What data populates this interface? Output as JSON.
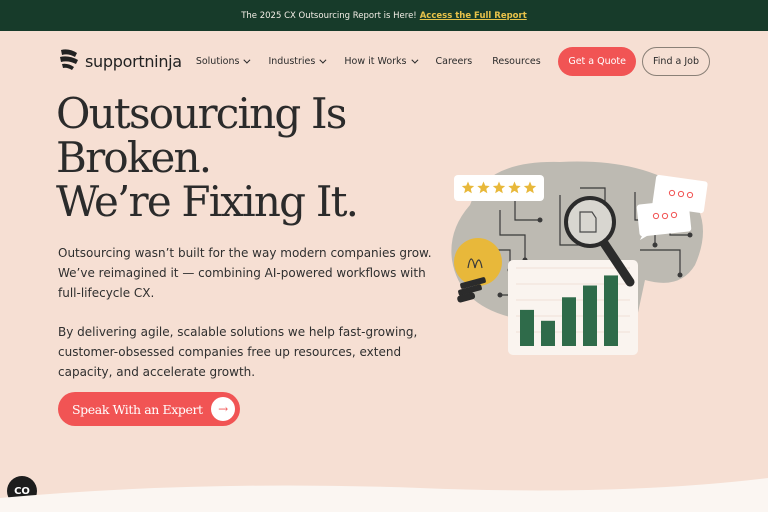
{
  "announcement": {
    "text": "The 2025 CX Outsourcing Report is Here!",
    "link": "Access the Full Report"
  },
  "brand": {
    "name": "supportninja",
    "logo_icon": "ninja-logo-icon"
  },
  "nav": {
    "items": [
      {
        "label": "Solutions",
        "has_dropdown": true
      },
      {
        "label": "Industries",
        "has_dropdown": true
      },
      {
        "label": "How it Works",
        "has_dropdown": true
      },
      {
        "label": "Careers",
        "has_dropdown": false
      },
      {
        "label": "Resources",
        "has_dropdown": false
      }
    ],
    "quote_button": "Get a Quote",
    "job_button": "Find a Job"
  },
  "hero": {
    "title_lines": [
      "Outsourcing Is",
      "Broken.",
      "We’re Fixing It."
    ],
    "paragraph1": "Outsourcing wasn’t built for the way modern companies grow. We’ve reimagined it — combining AI-powered workflows with full-lifecycle CX.",
    "paragraph2": "By delivering agile, scalable solutions we help fast-growing, customer-obsessed companies free up resources, extend capacity, and accelerate growth.",
    "cta": "Speak With an Expert"
  },
  "illustration": {
    "rating_stars": 5,
    "bar_values": [
      43,
      30,
      58,
      72,
      84
    ]
  },
  "colors": {
    "background": "#f6dfd3",
    "announcement_bg": "#173b2a",
    "accent": "#f15454",
    "highlight": "#e8c24a",
    "chart_bar": "#2f6b4a"
  },
  "chat_widget": {
    "icon": "chat-icon",
    "label": "CO"
  }
}
